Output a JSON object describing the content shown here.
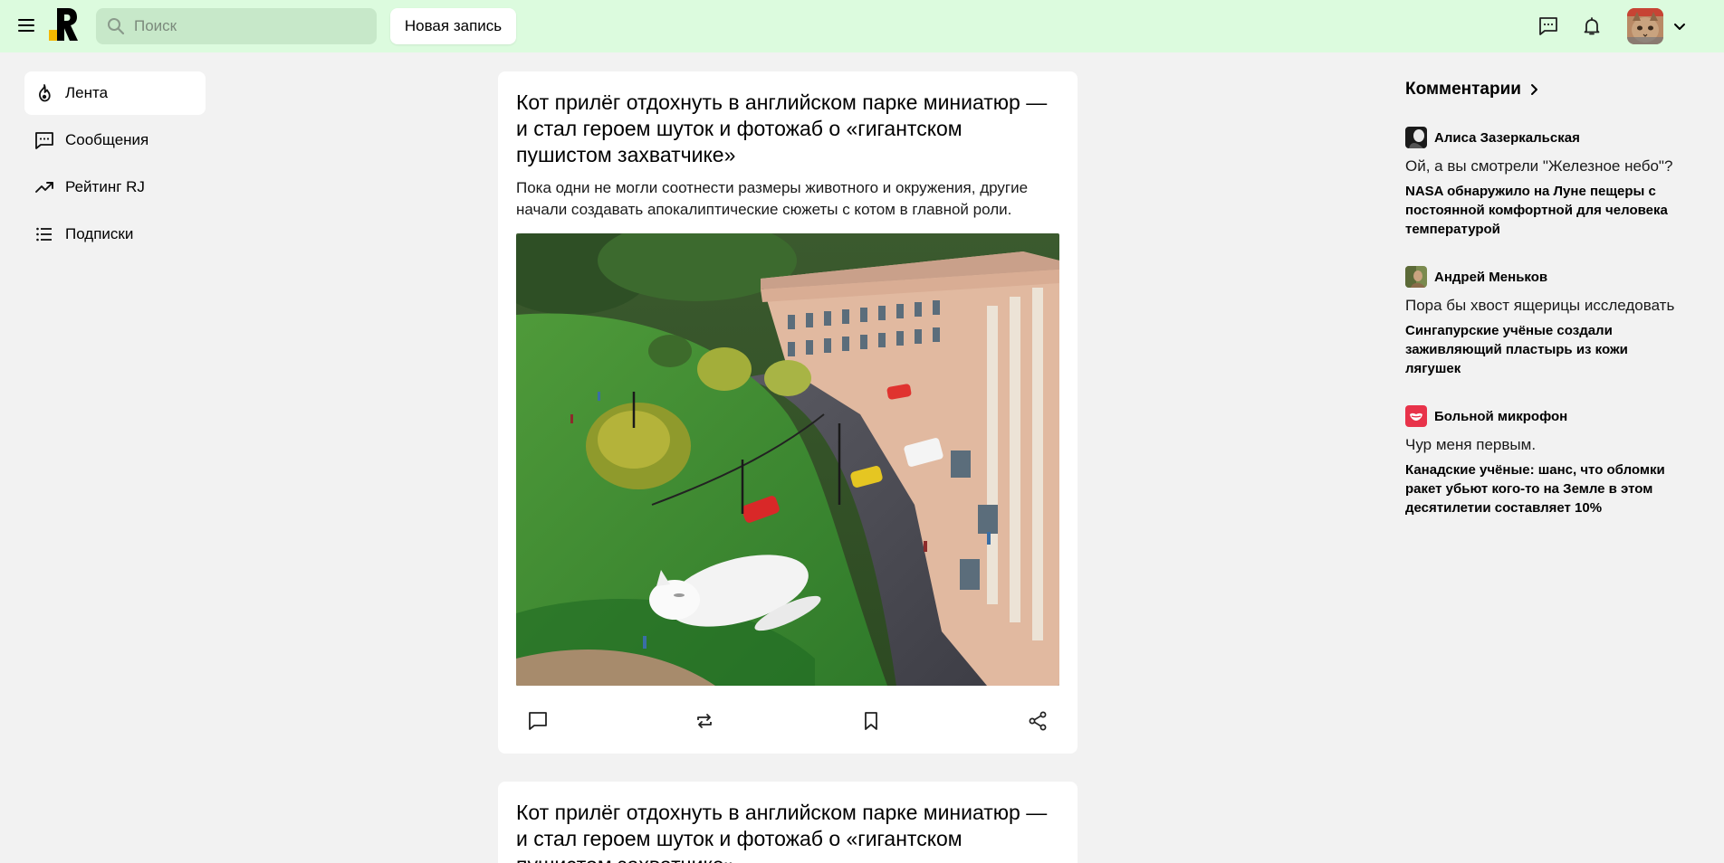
{
  "header": {
    "menu_icon": "hamburger-menu-icon",
    "logo_icon": "rj-logo",
    "search": {
      "placeholder": "Поиск",
      "value": "",
      "icon": "search-icon"
    },
    "new_post_label": "Новая запись",
    "messages_icon": "chat-icon",
    "notifications_icon": "bell-icon",
    "avatar_icon": "user-avatar-cat",
    "chevron_icon": "chevron-down-icon",
    "background_color": "#dcfbde"
  },
  "sidebar": {
    "items": [
      {
        "label": "Лента",
        "icon": "fire-icon",
        "active": true
      },
      {
        "label": "Сообщения",
        "icon": "chat-icon",
        "active": false
      },
      {
        "label": "Рейтинг RJ",
        "icon": "trending-icon",
        "active": false
      },
      {
        "label": "Подписки",
        "icon": "list-icon",
        "active": false
      }
    ]
  },
  "feed": {
    "posts": [
      {
        "title": "Кот прилёг отдохнуть в английском парке миниатюр — и стал героем шуток и фотожаб о «гигантском пушистом захватчике»",
        "lead": "Пока одни не могли соотнести размеры животного и окружения, другие начали создавать апокалиптические сюжеты с котом в главной роли.",
        "image": "white cat lying on the grass of a miniature park next to a model building and street",
        "actions": [
          "comment-icon",
          "repost-icon",
          "bookmark-icon",
          "share-icon"
        ]
      },
      {
        "title": "Кот прилёг отдохнуть в английском парке миниатюр — и стал героем шуток и фотожаб о «гигантском пушистом захватчике»"
      }
    ]
  },
  "comments": {
    "title": "Комментарии",
    "items": [
      {
        "author": "Алиса Зазеркальская",
        "text": "Ой, а вы смотрели \"Железное небо\"?",
        "article": "NASA обнаружило на Луне пещеры с постоянной комфортной для человека температурой"
      },
      {
        "author": "Андрей Меньков",
        "text": "Пора бы хвост ящерицы исследовать",
        "article": "Сингапурские учёные создали заживляющий пластырь из кожи лягушек"
      },
      {
        "author": "Больной микрофон",
        "text": "Чур меня первым.",
        "article": "Канадские учёные: шанс, что обломки ракет убьют кого-то на Земле в этом десятилетии составляет 10%"
      }
    ]
  }
}
